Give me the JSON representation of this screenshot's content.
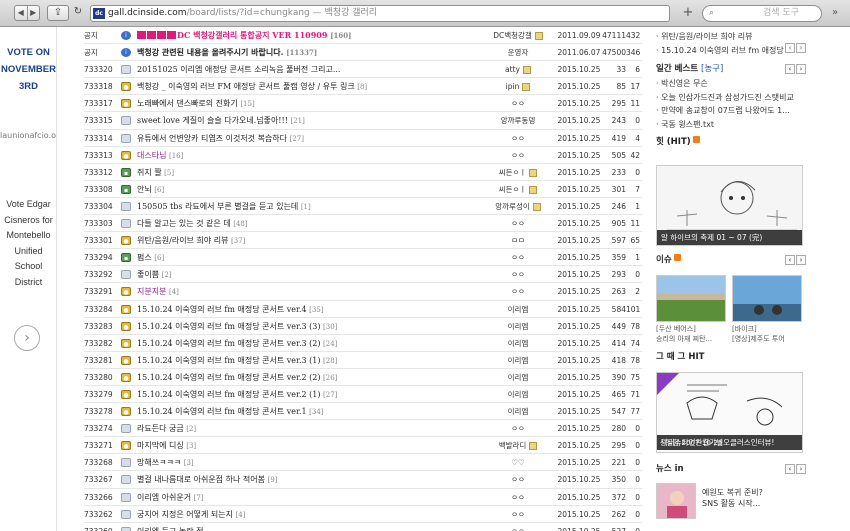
{
  "browser": {
    "url_host": "gall.dcinside.com",
    "url_path": "/board/lists/?id=chungkang",
    "url_suffix": " — 백청강 갤러리",
    "search_placeholder": "검색 도구",
    "favicon": "dc"
  },
  "left_ad": {
    "vote_lines": [
      "VOTE ON",
      "NOVEMBER",
      "3RD"
    ],
    "site": "launionafcio.o...",
    "vote_edgar_lines": [
      "Vote Edgar",
      "Cisneros for",
      "Montebello",
      "Unified School",
      "District"
    ]
  },
  "posts": [
    {
      "num": "공지",
      "icon": "info",
      "title": "DC 백청강갤러리 통합공지 VER 110909",
      "comments": "[160]",
      "writer": "DC백청강갤",
      "badge": true,
      "date": "2011.09.09",
      "views": "47111",
      "rec": "432",
      "cls": "notice n1",
      "blocks": 4
    },
    {
      "num": "공지",
      "icon": "info",
      "title": "백청강 관련된 내용을 올려주시기 바랍니다.",
      "comments": "[11337]",
      "writer": "운영자",
      "badge": false,
      "date": "2011.06.07",
      "views": "47500",
      "rec": "346",
      "cls": "notice"
    },
    {
      "num": "733320",
      "icon": "talk",
      "title": "20151025 이리엠 애정당 콘서트 소리녹음 풀버전 그리고...",
      "comments": "",
      "writer": "atty",
      "badge": true,
      "date": "2015.10.25",
      "views": "33",
      "rec": "6"
    },
    {
      "num": "733318",
      "icon": "user",
      "title": "백청강 _ 이숙영의 러브 FM 애정당 콘서트 풀캠 영상 / 유투 링크",
      "comments": "[8]",
      "writer": "ipin",
      "badge": true,
      "date": "2015.10.25",
      "views": "85",
      "rec": "17"
    },
    {
      "num": "733317",
      "icon": "user",
      "title": "노래빠에서 댄스빠로의 진화기",
      "comments": "[15]",
      "writer": "ㅇㅇ",
      "badge": false,
      "date": "2015.10.25",
      "views": "295",
      "rec": "11"
    },
    {
      "num": "733315",
      "icon": "talk",
      "title": "sweet love 게질이 슬슬 다가오네.넘좋아!!!",
      "comments": "[21]",
      "writer": "앙까루동뎅",
      "badge": false,
      "date": "2015.10.25",
      "views": "243",
      "rec": "0"
    },
    {
      "num": "733314",
      "icon": "talk",
      "title": "유튜에서 언변앙카 티엽즈 이것저것 복습하다",
      "comments": "[27]",
      "writer": "ㅇㅇ",
      "badge": false,
      "date": "2015.10.25",
      "views": "419",
      "rec": "4"
    },
    {
      "num": "733313",
      "icon": "user",
      "title": "대스타님",
      "comments": "[16]",
      "writer": "ㅇㅇ",
      "badge": false,
      "date": "2015.10.25",
      "views": "505",
      "rec": "42",
      "purple": true
    },
    {
      "num": "733312",
      "icon": "img",
      "title": "쥐지 짤",
      "comments": "[5]",
      "writer": "씨든ㅇㅣ",
      "badge": true,
      "date": "2015.10.25",
      "views": "233",
      "rec": "0"
    },
    {
      "num": "733308",
      "icon": "img",
      "title": "안뇌",
      "comments": "[6]",
      "writer": "씨든ㅇㅣ",
      "badge": true,
      "date": "2015.10.25",
      "views": "301",
      "rec": "7"
    },
    {
      "num": "733304",
      "icon": "talk",
      "title": "150505 tbs 라됴에서 부른 별걸을 듣고 있는데",
      "comments": "[1]",
      "writer": "앙까루성이",
      "badge": true,
      "date": "2015.10.25",
      "views": "246",
      "rec": "1"
    },
    {
      "num": "733303",
      "icon": "talk",
      "title": "다들 알고는 있는 것 같은 데",
      "comments": "[48]",
      "writer": "ㅇㅇ",
      "badge": false,
      "date": "2015.10.25",
      "views": "905",
      "rec": "11"
    },
    {
      "num": "733301",
      "icon": "user",
      "title": "위탄/음원/라이브 희야 리뷰",
      "comments": "[37]",
      "writer": "ㅁㅁ",
      "badge": false,
      "date": "2015.10.25",
      "views": "597",
      "rec": "65"
    },
    {
      "num": "733294",
      "icon": "img",
      "title": "펌스",
      "comments": "[6]",
      "writer": "ㅇㅇ",
      "badge": false,
      "date": "2015.10.25",
      "views": "359",
      "rec": "1"
    },
    {
      "num": "733292",
      "icon": "talk",
      "title": "좋이쁨",
      "comments": "[2]",
      "writer": "ㅇㅇ",
      "badge": false,
      "date": "2015.10.25",
      "views": "293",
      "rec": "0"
    },
    {
      "num": "733291",
      "icon": "user",
      "title": "지분지분",
      "comments": "[4]",
      "writer": "ㅇㅇ",
      "badge": false,
      "date": "2015.10.25",
      "views": "263",
      "rec": "2",
      "purple": true
    },
    {
      "num": "733284",
      "icon": "user",
      "title": "15.10.24 이숙영의 러브 fm 애정당 콘서트 ver.4",
      "comments": "[35]",
      "writer": "이리엠",
      "badge": false,
      "date": "2015.10.25",
      "views": "584",
      "rec": "101"
    },
    {
      "num": "733283",
      "icon": "user",
      "title": "15.10.24 이숙영의 러브 fm 애정당 콘서트 ver.3 (3)",
      "comments": "[30]",
      "writer": "이리엠",
      "badge": false,
      "date": "2015.10.25",
      "views": "449",
      "rec": "78"
    },
    {
      "num": "733282",
      "icon": "user",
      "title": "15.10.24 이숙영의 러브 fm 애정당 콘서트 ver.3 (2)",
      "comments": "[24]",
      "writer": "이리엠",
      "badge": false,
      "date": "2015.10.25",
      "views": "414",
      "rec": "74"
    },
    {
      "num": "733281",
      "icon": "user",
      "title": "15.10.24 이숙영의 러브 fm 애정당 콘서트 ver.3 (1)",
      "comments": "[28]",
      "writer": "이리엠",
      "badge": false,
      "date": "2015.10.25",
      "views": "418",
      "rec": "78"
    },
    {
      "num": "733280",
      "icon": "user",
      "title": "15.10.24 이숙영의 러브 fm 애정당 콘서트 ver.2 (2)",
      "comments": "[26]",
      "writer": "이리엠",
      "badge": false,
      "date": "2015.10.25",
      "views": "390",
      "rec": "75"
    },
    {
      "num": "733279",
      "icon": "user",
      "title": "15.10.24 이숙영의 러브 fm 애정당 콘서트 ver.2 (1)",
      "comments": "[27]",
      "writer": "이리엠",
      "badge": false,
      "date": "2015.10.25",
      "views": "465",
      "rec": "71"
    },
    {
      "num": "733278",
      "icon": "user",
      "title": "15.10.24 이숙영의 러브 fm 애정당 콘서트 ver.1",
      "comments": "[34]",
      "writer": "이리엠",
      "badge": false,
      "date": "2015.10.25",
      "views": "547",
      "rec": "77"
    },
    {
      "num": "733274",
      "icon": "talk",
      "title": "라됴든다 궁금",
      "comments": "[2]",
      "writer": "ㅇㅇ",
      "badge": false,
      "date": "2015.10.25",
      "views": "280",
      "rec": "0"
    },
    {
      "num": "733271",
      "icon": "user",
      "title": "마지막에 디싱",
      "comments": "[3]",
      "writer": "백발라디",
      "badge": true,
      "date": "2015.10.25",
      "views": "295",
      "rec": "0"
    },
    {
      "num": "733268",
      "icon": "talk",
      "title": "망해쓰ㅋㅋㅋ",
      "comments": "[3]",
      "writer": "♡♡",
      "badge": false,
      "date": "2015.10.25",
      "views": "221",
      "rec": "0"
    },
    {
      "num": "733267",
      "icon": "talk",
      "title": "별걸 내나름대로 아쉬운점 하나 적어봄",
      "comments": "[9]",
      "writer": "ㅇㅇ",
      "badge": false,
      "date": "2015.10.25",
      "views": "350",
      "rec": "0"
    },
    {
      "num": "733266",
      "icon": "talk",
      "title": "이리엠 아쉬운거",
      "comments": "[7]",
      "writer": "ㅇㅇ",
      "badge": false,
      "date": "2015.10.25",
      "views": "372",
      "rec": "0"
    },
    {
      "num": "733262",
      "icon": "talk",
      "title": "궁지어 지정은 어떻게 되는지",
      "comments": "[4]",
      "writer": "ㅇㅇ",
      "badge": false,
      "date": "2015.10.25",
      "views": "262",
      "rec": "0"
    },
    {
      "num": "733260",
      "icon": "talk",
      "title": "이리엠 듣고 놀란 점",
      "comments": "",
      "writer": "ㅇㅇ",
      "badge": false,
      "date": "2015.10.25",
      "views": "527",
      "rec": "0"
    }
  ],
  "sidebar": {
    "top_items": [
      "· 위탄/음원/라이브 희야 리뷰",
      "· 15.10.24 이숙영의 러브 fm 애정당"
    ],
    "daily_title": "일간 베스트",
    "daily_tag": "[농구]",
    "daily_items": [
      "· 박신영은 무슨",
      "· 오늘 인삼가드진과 삼성가드진 스탯비교",
      "· 만약에 송교창이 07드랩 나왔어도 1...",
      "· 국동 윙스팬.txt"
    ],
    "hit_title": "힛 (HIT)",
    "hit_caption": "알 하이브의 축제 01 ~ 07 (完)",
    "issue_title": "이슈",
    "issue_captions": [
      [
        "[두산 베어스]",
        "승리의 아재 찌탄..."
      ],
      [
        "[바이크]",
        "[영상]제주도 투어"
      ]
    ],
    "trend_title": "그 때 그 HIT",
    "trend_caption": "닥터슈타인완결기념오클러스인터뷰!",
    "trend_sub": "성질환 2007-10-25",
    "news_title": "뉴스 in",
    "news_lines": [
      "예원도 복귀 준비?",
      "SNS 활동 시작..."
    ]
  }
}
